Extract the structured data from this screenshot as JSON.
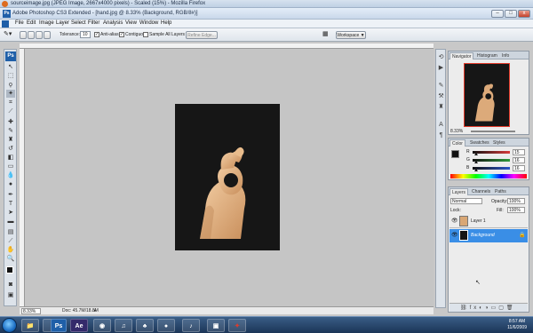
{
  "firefox": {
    "title": "sourceimage.jpg (JPEG Image, 2667x4000 pixels) - Scaled (15%) - Mozilla Firefox"
  },
  "photoshop": {
    "title": "Adobe Photoshop CS3 Extended - [hand.jpg @ 8.33% (Background, RGB/8#)]",
    "logo": "Ps",
    "window_buttons": [
      "–",
      "□",
      "x"
    ]
  },
  "menu": [
    "File",
    "Edit",
    "Image",
    "Layer",
    "Select",
    "Filter",
    "Analysis",
    "View",
    "Window",
    "Help"
  ],
  "options": {
    "tolerance_label": "Tolerance:",
    "tolerance_value": "10",
    "antialias_label": "Anti-alias",
    "contiguous_label": "Contiguous",
    "sample_all_label": "Sample All Layers",
    "refine_button": "Refine Edge...",
    "workspace_button": "Workspace ▼"
  },
  "status": {
    "zoom": "8.33%",
    "doc": "Doc: 45.7M/18.8M"
  },
  "navigator": {
    "tabs": [
      "Navigator",
      "Histogram",
      "Info"
    ],
    "zoom": "8.33%"
  },
  "color_panel": {
    "tabs": [
      "Color",
      "Swatches",
      "Styles"
    ],
    "channels": [
      {
        "label": "R",
        "value": "15",
        "color": "#d83a3a",
        "level": 0.06
      },
      {
        "label": "G",
        "value": "16",
        "color": "#2d9a3a",
        "level": 0.06
      },
      {
        "label": "B",
        "value": "16",
        "color": "#2b55c8",
        "level": 0.06
      }
    ]
  },
  "layers_panel": {
    "tabs": [
      "Layers",
      "Channels",
      "Paths"
    ],
    "blend_mode": "Normal",
    "opacity_label": "Opacity:",
    "opacity_value": "100%",
    "lock_label": "Lock:",
    "fill_label": "Fill:",
    "fill_value": "100%",
    "layers": [
      {
        "name": "Layer 1",
        "selected": false
      },
      {
        "name": "Background",
        "selected": true
      }
    ]
  },
  "taskbar": {
    "apps": [
      "📁",
      "",
      "Ps",
      "Ae",
      "◉",
      "♫",
      "♣",
      "●",
      "♪",
      "▣",
      "✦"
    ],
    "time": "8:57 AM",
    "date": "11/6/2009"
  },
  "colors": {
    "accent": "#3a8ee6",
    "document": "#161616",
    "skin": "#e2b488"
  }
}
